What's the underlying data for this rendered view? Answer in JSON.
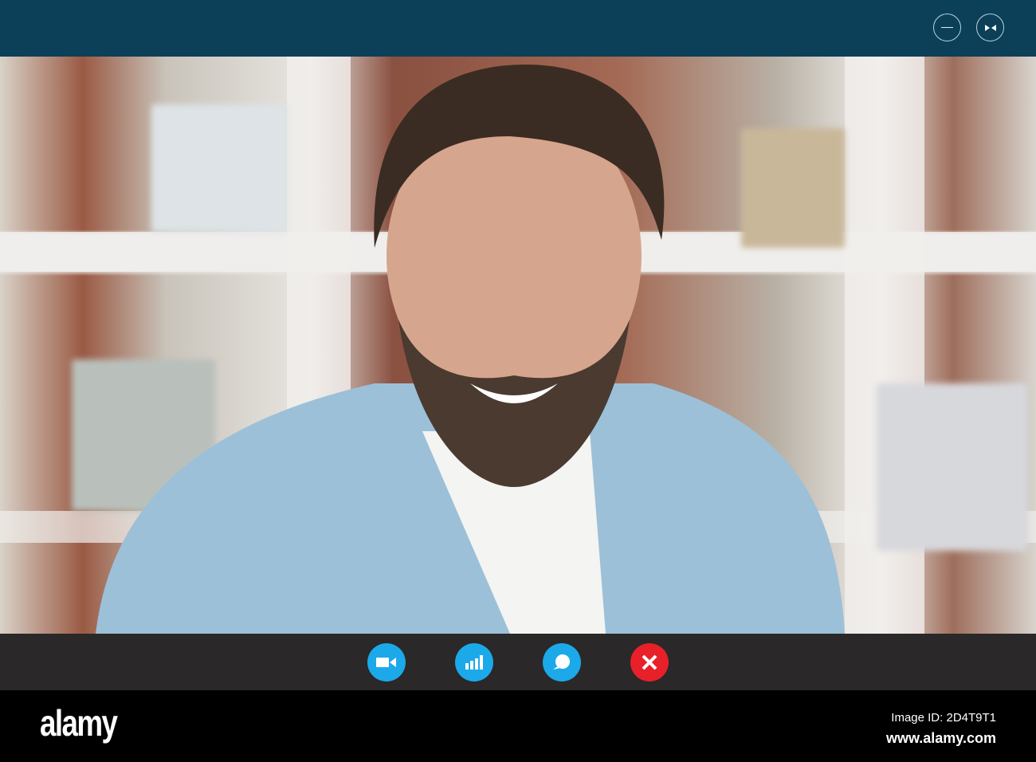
{
  "window": {
    "minimize_label": "Minimize",
    "collapse_label": "Collapse"
  },
  "call_controls": [
    {
      "name": "camera",
      "icon": "video-camera-icon",
      "color": "#1ba9ea"
    },
    {
      "name": "signal",
      "icon": "signal-bars-icon",
      "color": "#1ba9ea"
    },
    {
      "name": "chat",
      "icon": "chat-bubble-icon",
      "color": "#1ba9ea"
    },
    {
      "name": "end-call",
      "icon": "close-icon",
      "color": "#e8202a"
    }
  ],
  "footer": {
    "logo": "alamy",
    "image_id": "Image ID: 2D4T9T1",
    "url": "www.alamy.com"
  },
  "colors": {
    "titlebar": "#0c4058",
    "toolbar": "#2a2828",
    "accent": "#1ba9ea",
    "danger": "#e8202a"
  }
}
